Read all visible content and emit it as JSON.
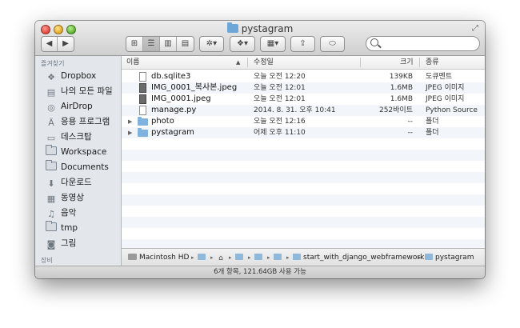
{
  "window": {
    "title": "pystagram"
  },
  "toolbar": {
    "back_label": "◀",
    "forward_label": "▶",
    "view_icon_label": "⊞",
    "view_list_label": "☰",
    "view_column_label": "▥",
    "view_coverflow_label": "▤",
    "action_label": "✲▾",
    "dropbox_label": "❖▾",
    "arrange_label": "▦▾",
    "share_label": "⇪",
    "tags_label": "⬭",
    "search_placeholder": ""
  },
  "sidebar": {
    "favorites_heading": "즐겨찾기",
    "devices_heading": "장비",
    "items": [
      {
        "label": "Dropbox",
        "icon": "dropbox-icon"
      },
      {
        "label": "나의 모든 파일",
        "icon": "all-files-icon"
      },
      {
        "label": "AirDrop",
        "icon": "airdrop-icon"
      },
      {
        "label": "응용 프로그램",
        "icon": "applications-icon"
      },
      {
        "label": "데스크탑",
        "icon": "desktop-icon"
      },
      {
        "label": "Workspace",
        "icon": "folder-icon"
      },
      {
        "label": "Documents",
        "icon": "folder-icon"
      },
      {
        "label": "다운로드",
        "icon": "downloads-icon"
      },
      {
        "label": "동영상",
        "icon": "movies-icon"
      },
      {
        "label": "음악",
        "icon": "music-icon"
      },
      {
        "label": "tmp",
        "icon": "folder-icon"
      },
      {
        "label": "그림",
        "icon": "pictures-icon"
      }
    ]
  },
  "columns": {
    "name": "이름",
    "date": "수정일",
    "size": "크기",
    "kind": "종류",
    "sort_indicator": "▲"
  },
  "files": [
    {
      "name": "db.sqlite3",
      "date": "오늘 오전 12:20",
      "size": "139KB",
      "kind": "도큐멘트",
      "type": "file"
    },
    {
      "name": "IMG_0001_복사본.jpeg",
      "date": "오늘 오전 12:01",
      "size": "1.6MB",
      "kind": "JPEG 이미지",
      "type": "jpeg"
    },
    {
      "name": "IMG_0001.jpeg",
      "date": "오늘 오전 12:01",
      "size": "1.6MB",
      "kind": "JPEG 이미지",
      "type": "jpeg"
    },
    {
      "name": "manage.py",
      "date": "2014. 8. 31. 오후 10:41",
      "size": "252바이트",
      "kind": "Python Source",
      "type": "file"
    },
    {
      "name": "photo",
      "date": "오늘 오전 12:16",
      "size": "--",
      "kind": "폴더",
      "type": "folder",
      "disclosure": "▶"
    },
    {
      "name": "pystagram",
      "date": "어제 오후 11:10",
      "size": "--",
      "kind": "폴더",
      "type": "folder",
      "disclosure": "▶"
    }
  ],
  "pathbar": {
    "root": "Macintosh HD",
    "segments": [
      "start_with_django_webframework",
      "pystagram"
    ],
    "separator": "▸"
  },
  "status": "6개 항목, 121.64GB 사용 가능"
}
